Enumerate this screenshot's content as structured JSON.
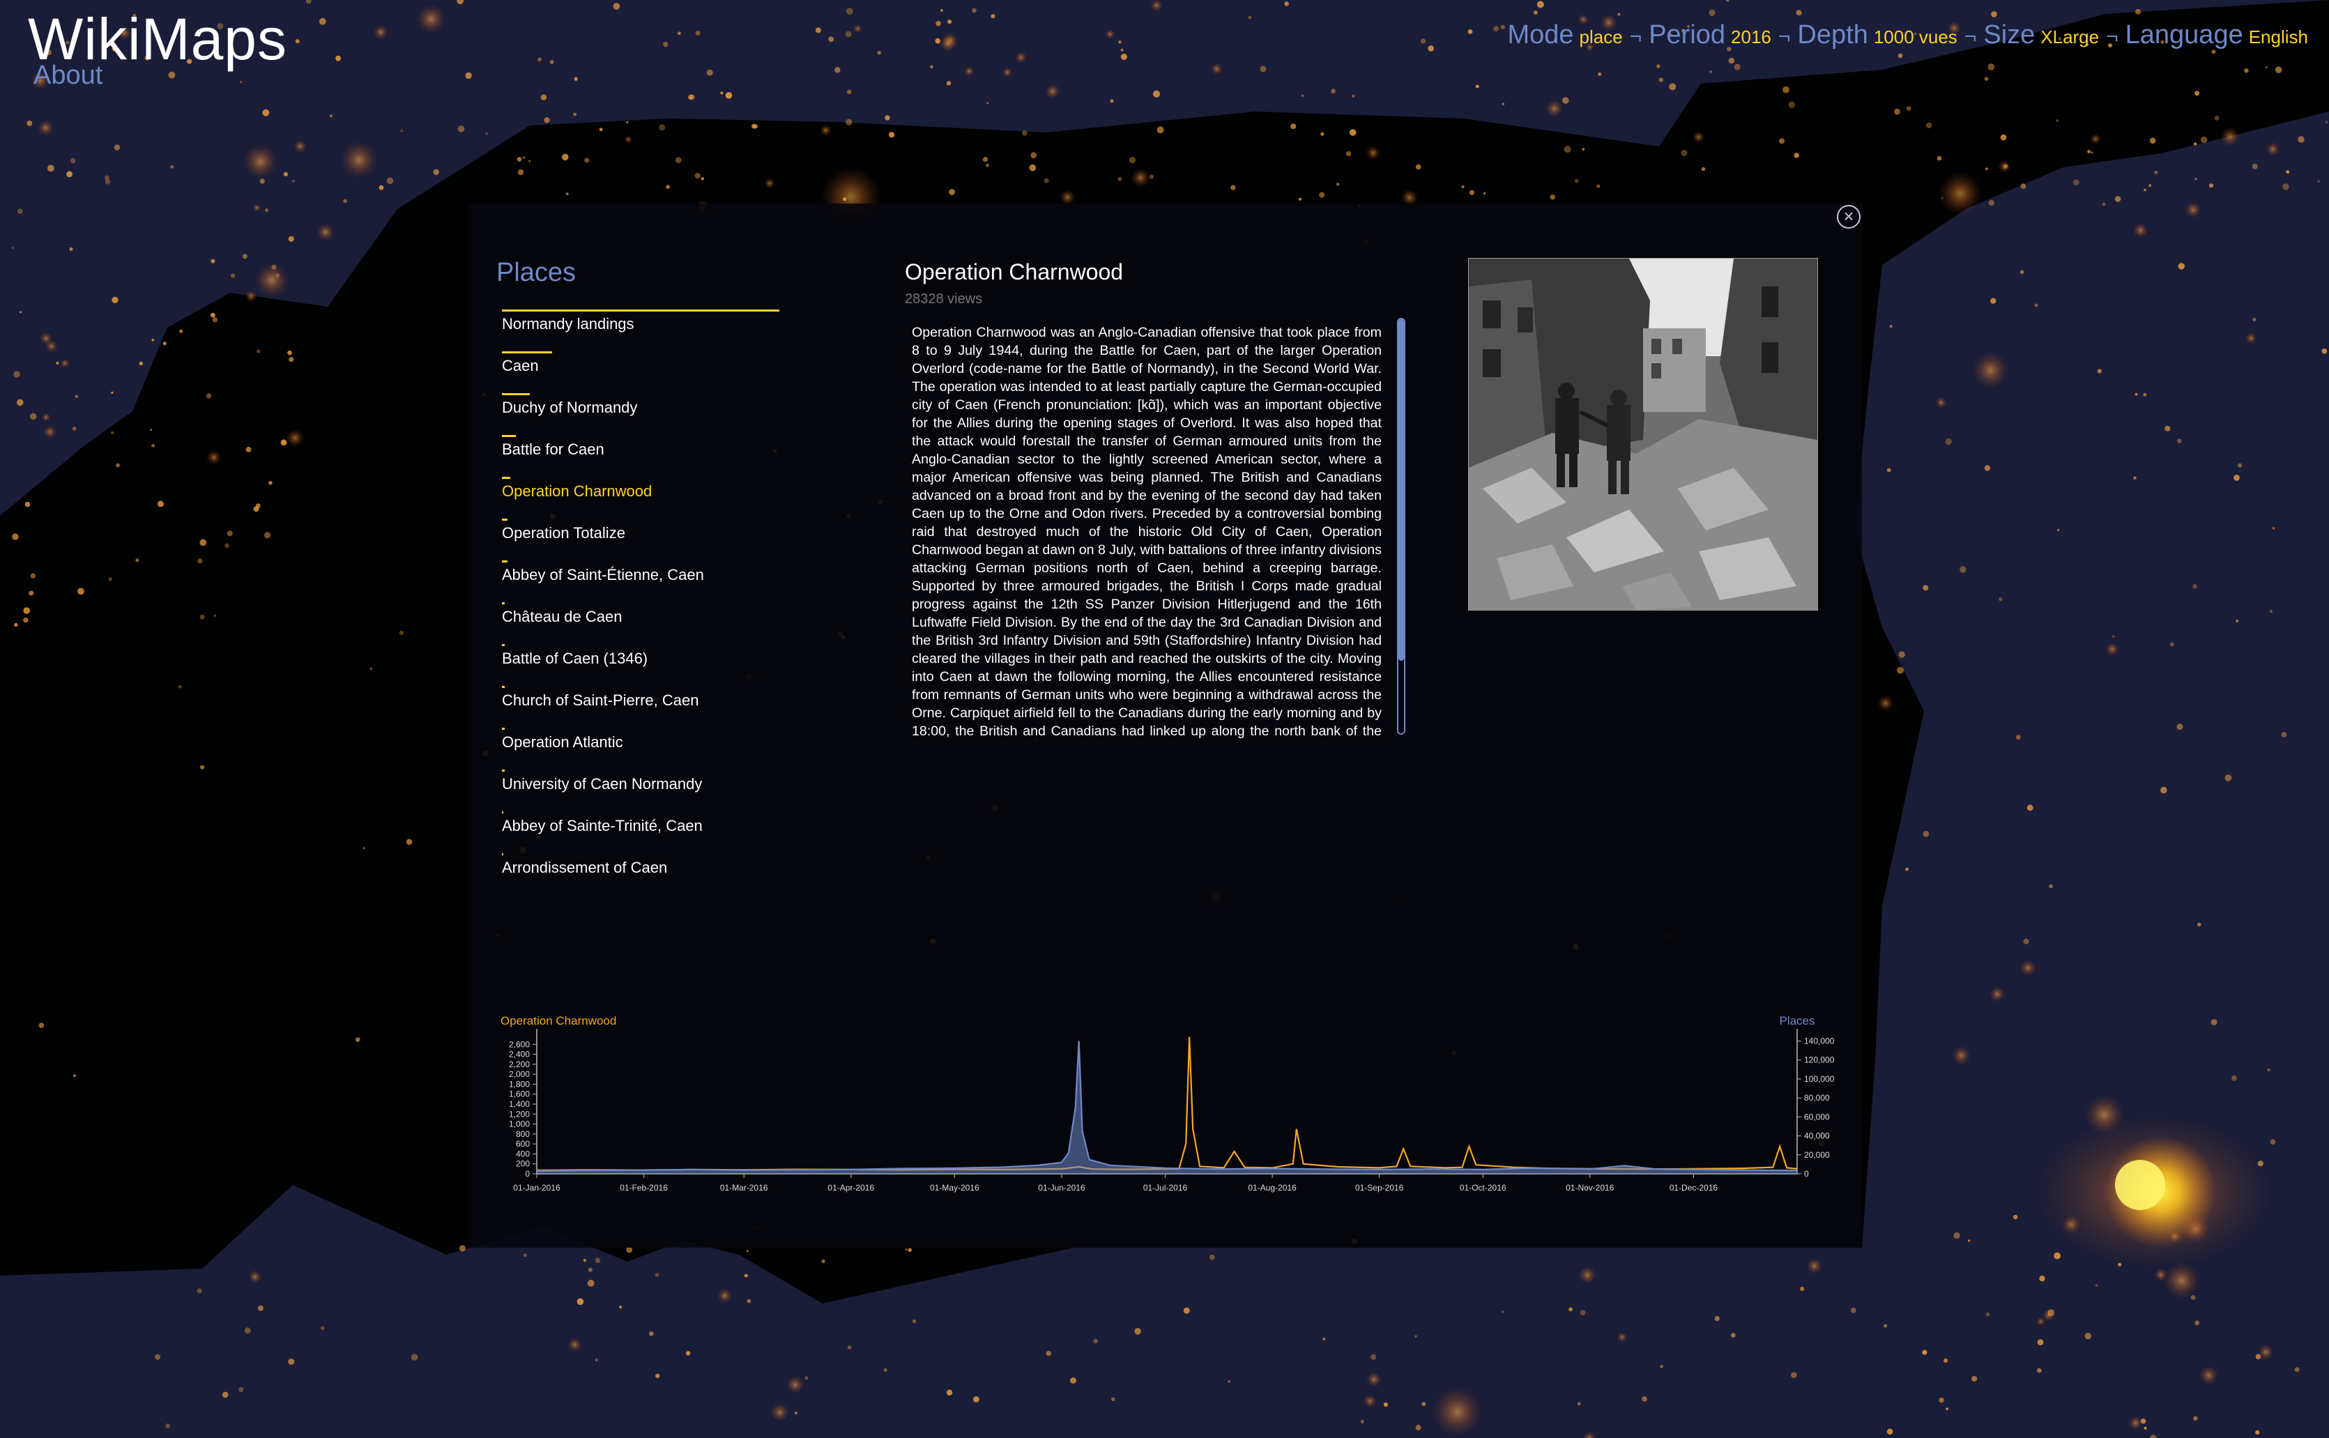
{
  "app": {
    "title": "WikiMaps",
    "about_label": "About"
  },
  "settings": [
    {
      "label": "Mode",
      "value": "place"
    },
    {
      "label": "Period",
      "value": "2016"
    },
    {
      "label": "Depth",
      "value": "1000 vues"
    },
    {
      "label": "Size",
      "value": "XLarge"
    },
    {
      "label": "Language",
      "value": "English"
    }
  ],
  "separator": "¬",
  "places": {
    "title": "Places",
    "items": [
      {
        "label": "Normandy landings",
        "share": 1.0
      },
      {
        "label": "Caen",
        "share": 0.18
      },
      {
        "label": "Duchy of Normandy",
        "share": 0.1
      },
      {
        "label": "Battle for Caen",
        "share": 0.05
      },
      {
        "label": "Operation Charnwood",
        "share": 0.03,
        "active": true
      },
      {
        "label": "Operation Totalize",
        "share": 0.02
      },
      {
        "label": "Abbey of Saint-Étienne, Caen",
        "share": 0.02
      },
      {
        "label": "Château de Caen",
        "share": 0.01
      },
      {
        "label": "Battle of Caen (1346)",
        "share": 0.01
      },
      {
        "label": "Church of Saint-Pierre, Caen",
        "share": 0.01
      },
      {
        "label": "Operation Atlantic",
        "share": 0.01
      },
      {
        "label": "University of Caen Normandy",
        "share": 0.01
      },
      {
        "label": "Abbey of Sainte-Trinité, Caen",
        "share": 0.0
      },
      {
        "label": "Arrondissement of Caen",
        "share": 0.0
      }
    ]
  },
  "article": {
    "title": "Operation Charnwood",
    "views": "28328 views",
    "body": "Operation Charnwood was an Anglo-Canadian offensive that took place from 8 to 9 July 1944, during the Battle for Caen, part of the larger Operation Overlord (code-name for the Battle of Normandy), in the Second World War. The operation was intended to at least partially capture the German-occupied city of Caen (French pronunciation: [kɑ̃]), which was an important objective for the Allies during the opening stages of Overlord. It was also hoped that the attack would forestall the transfer of German armoured units from the Anglo-Canadian sector to the lightly screened American sector, where a major American offensive was being planned. The British and Canadians advanced on a broad front and by the evening of the second day had taken Caen up to the Orne and Odon rivers. Preceded by a controversial bombing raid that destroyed much of the historic Old City of Caen, Operation Charnwood began at dawn on 8 July, with battalions of three infantry divisions attacking German positions north of Caen, behind a creeping barrage. Supported by three armoured brigades, the British I Corps made gradual progress against the 12th SS Panzer Division Hitlerjugend and the 16th Luftwaffe Field Division. By the end of the day the 3rd Canadian Division and the British 3rd Infantry Division and 59th (Staffordshire) Infantry Division had cleared the villages in their path and reached the outskirts of the city. Moving into Caen at dawn the following morning, the Allies encountered resistance from remnants of German units who were beginning a withdrawal across the Orne. Carpiquet airfield fell to the Canadians during the early morning and by 18:00, the British and Canadians had linked up along the north bank of the Orne. The remaining bridges were defended or impassable and with German reserves positioned to oppose their crossing, I Corps ended the operation. With the capture of northern Caen and the many casualties inflicted on the German defenders, Operation Charnwood was a mutually costly tactical success for the Allies. Operationally, the Germans retired from north of the Orne River but did not stop sending formations to the American front. The Germans established another defensive line along two ridges to the south of the city. The Allies maintained the initiative and began Operation Jupiter the next day and"
  },
  "chart_data": {
    "type": "line",
    "x_ticks": [
      "01-Jan-2016",
      "01-Feb-2016",
      "01-Mar-2016",
      "01-Apr-2016",
      "01-May-2016",
      "01-Jun-2016",
      "01-Jul-2016",
      "01-Aug-2016",
      "01-Sep-2016",
      "01-Oct-2016",
      "01-Nov-2016",
      "01-Dec-2016"
    ],
    "xlim": [
      "2016-01-01",
      "2016-12-31"
    ],
    "left_axis": {
      "label": "Operation Charnwood",
      "ylim": [
        0,
        2800
      ],
      "ticks": [
        0,
        200,
        400,
        600,
        800,
        1000,
        1200,
        1400,
        1600,
        1800,
        2000,
        2200,
        2400,
        2600
      ]
    },
    "right_axis": {
      "label": "Places",
      "ylim": [
        0,
        147000
      ],
      "ticks": [
        0,
        20000,
        40000,
        60000,
        80000,
        100000,
        120000,
        140000
      ]
    },
    "series": [
      {
        "name": "Operation Charnwood",
        "axis": "left",
        "color": "#f5a623",
        "points": [
          [
            "2016-01-01",
            70
          ],
          [
            "2016-01-15",
            80
          ],
          [
            "2016-02-01",
            75
          ],
          [
            "2016-02-15",
            85
          ],
          [
            "2016-03-01",
            80
          ],
          [
            "2016-03-15",
            90
          ],
          [
            "2016-04-01",
            85
          ],
          [
            "2016-04-15",
            80
          ],
          [
            "2016-05-01",
            90
          ],
          [
            "2016-05-15",
            85
          ],
          [
            "2016-06-01",
            100
          ],
          [
            "2016-06-06",
            140
          ],
          [
            "2016-06-10",
            95
          ],
          [
            "2016-06-20",
            90
          ],
          [
            "2016-07-05",
            100
          ],
          [
            "2016-07-07",
            600
          ],
          [
            "2016-07-08",
            2750
          ],
          [
            "2016-07-09",
            900
          ],
          [
            "2016-07-11",
            150
          ],
          [
            "2016-07-18",
            120
          ],
          [
            "2016-07-21",
            450
          ],
          [
            "2016-07-24",
            130
          ],
          [
            "2016-08-01",
            120
          ],
          [
            "2016-08-07",
            200
          ],
          [
            "2016-08-08",
            900
          ],
          [
            "2016-08-10",
            200
          ],
          [
            "2016-08-20",
            140
          ],
          [
            "2016-09-01",
            120
          ],
          [
            "2016-09-06",
            150
          ],
          [
            "2016-09-08",
            500
          ],
          [
            "2016-09-10",
            150
          ],
          [
            "2016-09-20",
            120
          ],
          [
            "2016-09-25",
            130
          ],
          [
            "2016-09-27",
            550
          ],
          [
            "2016-09-29",
            180
          ],
          [
            "2016-10-10",
            130
          ],
          [
            "2016-10-20",
            110
          ],
          [
            "2016-11-01",
            100
          ],
          [
            "2016-11-15",
            95
          ],
          [
            "2016-12-01",
            100
          ],
          [
            "2016-12-15",
            110
          ],
          [
            "2016-12-24",
            130
          ],
          [
            "2016-12-26",
            550
          ],
          [
            "2016-12-28",
            120
          ],
          [
            "2016-12-31",
            100
          ]
        ]
      },
      {
        "name": "Places",
        "axis": "right",
        "color": "#6d89c8",
        "points": [
          [
            "2016-01-01",
            3000
          ],
          [
            "2016-01-15",
            3500
          ],
          [
            "2016-02-01",
            4000
          ],
          [
            "2016-02-15",
            4500
          ],
          [
            "2016-03-01",
            3800
          ],
          [
            "2016-03-15",
            4200
          ],
          [
            "2016-04-01",
            4500
          ],
          [
            "2016-04-15",
            5500
          ],
          [
            "2016-05-01",
            6000
          ],
          [
            "2016-05-15",
            7000
          ],
          [
            "2016-05-25",
            9000
          ],
          [
            "2016-06-01",
            12000
          ],
          [
            "2016-06-03",
            22000
          ],
          [
            "2016-06-05",
            70000
          ],
          [
            "2016-06-06",
            140000
          ],
          [
            "2016-06-07",
            45000
          ],
          [
            "2016-06-09",
            15000
          ],
          [
            "2016-06-15",
            9000
          ],
          [
            "2016-07-01",
            6000
          ],
          [
            "2016-07-15",
            5000
          ],
          [
            "2016-08-01",
            5500
          ],
          [
            "2016-08-15",
            5000
          ],
          [
            "2016-09-01",
            4500
          ],
          [
            "2016-09-15",
            5000
          ],
          [
            "2016-10-01",
            4500
          ],
          [
            "2016-10-15",
            6000
          ],
          [
            "2016-11-01",
            5000
          ],
          [
            "2016-11-11",
            8500
          ],
          [
            "2016-11-20",
            5000
          ],
          [
            "2016-12-01",
            4500
          ],
          [
            "2016-12-15",
            4000
          ],
          [
            "2016-12-31",
            3500
          ]
        ]
      }
    ]
  }
}
